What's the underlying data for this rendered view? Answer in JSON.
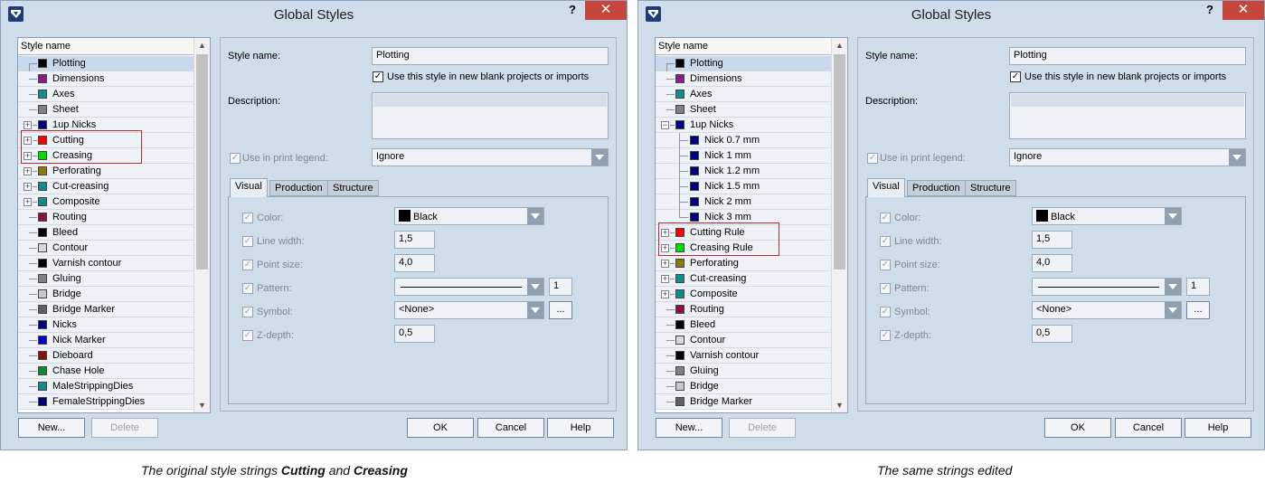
{
  "dialogs": [
    {
      "title": "Global Styles",
      "help_glyph": "?",
      "close_glyph": "✕",
      "list_header": "Style name",
      "rows": [
        {
          "label": "Plotting",
          "color": "#000000",
          "expander": "none",
          "selected": true
        },
        {
          "label": "Dimensions",
          "color": "#8b1a8b",
          "expander": "none"
        },
        {
          "label": "Axes",
          "color": "#1a8a8a",
          "expander": "none"
        },
        {
          "label": "Sheet",
          "color": "#808080",
          "expander": "none"
        },
        {
          "label": "1up Nicks",
          "color": "#00007f",
          "expander": "plus"
        },
        {
          "label": "Cutting",
          "color": "#ff0000",
          "expander": "plus"
        },
        {
          "label": "Creasing",
          "color": "#00dd00",
          "expander": "plus"
        },
        {
          "label": "Perforating",
          "color": "#8a7a10",
          "expander": "plus"
        },
        {
          "label": "Cut-creasing",
          "color": "#108a8a",
          "expander": "plus"
        },
        {
          "label": "Composite",
          "color": "#108a8a",
          "expander": "plus"
        },
        {
          "label": "Routing",
          "color": "#8a1040",
          "expander": "none"
        },
        {
          "label": "Bleed",
          "color": "#000000",
          "expander": "none"
        },
        {
          "label": "Contour",
          "color": "#d8d8d8",
          "expander": "none"
        },
        {
          "label": "Varnish contour",
          "color": "#000000",
          "expander": "none"
        },
        {
          "label": "Gluing",
          "color": "#808080",
          "expander": "none"
        },
        {
          "label": "Bridge",
          "color": "#c8c8c8",
          "expander": "none"
        },
        {
          "label": "Bridge Marker",
          "color": "#606060",
          "expander": "none"
        },
        {
          "label": "Nicks",
          "color": "#00007f",
          "expander": "none"
        },
        {
          "label": "Nick Marker",
          "color": "#0000cc",
          "expander": "none"
        },
        {
          "label": "Dieboard",
          "color": "#8a1010",
          "expander": "none"
        },
        {
          "label": "Chase Hole",
          "color": "#108a30",
          "expander": "none"
        },
        {
          "label": "MaleStrippingDies",
          "color": "#108a8a",
          "expander": "none"
        },
        {
          "label": "FemaleStrippingDies",
          "color": "#00007f",
          "expander": "none"
        }
      ],
      "caption_parts": [
        "The original style strings ",
        "Cutting",
        " and ",
        "Creasing"
      ]
    },
    {
      "title": "Global Styles",
      "help_glyph": "?",
      "close_glyph": "✕",
      "list_header": "Style name",
      "rows": [
        {
          "label": "Plotting",
          "color": "#000000",
          "expander": "none",
          "selected": true
        },
        {
          "label": "Dimensions",
          "color": "#8b1a8b",
          "expander": "none"
        },
        {
          "label": "Axes",
          "color": "#1a8a8a",
          "expander": "none"
        },
        {
          "label": "Sheet",
          "color": "#808080",
          "expander": "none"
        },
        {
          "label": "1up Nicks",
          "color": "#00007f",
          "expander": "minus"
        },
        {
          "label": "Nick 0.7 mm",
          "color": "#00007f",
          "expander": "child"
        },
        {
          "label": "Nick 1 mm",
          "color": "#00007f",
          "expander": "child"
        },
        {
          "label": "Nick 1.2 mm",
          "color": "#00007f",
          "expander": "child"
        },
        {
          "label": "Nick 1.5 mm",
          "color": "#00007f",
          "expander": "child"
        },
        {
          "label": "Nick 2 mm",
          "color": "#00007f",
          "expander": "child"
        },
        {
          "label": "Nick 3 mm",
          "color": "#00007f",
          "expander": "childlast"
        },
        {
          "label": "Cutting Rule",
          "color": "#ff0000",
          "expander": "plus"
        },
        {
          "label": "Creasing Rule",
          "color": "#00dd00",
          "expander": "plus"
        },
        {
          "label": "Perforating",
          "color": "#8a7a10",
          "expander": "plus"
        },
        {
          "label": "Cut-creasing",
          "color": "#108a8a",
          "expander": "plus"
        },
        {
          "label": "Composite",
          "color": "#108a8a",
          "expander": "plus"
        },
        {
          "label": "Routing",
          "color": "#8a1040",
          "expander": "none"
        },
        {
          "label": "Bleed",
          "color": "#000000",
          "expander": "none"
        },
        {
          "label": "Contour",
          "color": "#d8d8d8",
          "expander": "none"
        },
        {
          "label": "Varnish contour",
          "color": "#000000",
          "expander": "none"
        },
        {
          "label": "Gluing",
          "color": "#808080",
          "expander": "none"
        },
        {
          "label": "Bridge",
          "color": "#c8c8c8",
          "expander": "none"
        },
        {
          "label": "Bridge Marker",
          "color": "#606060",
          "expander": "none"
        }
      ],
      "caption_parts": [
        "The same strings edited"
      ]
    }
  ],
  "form": {
    "style_name_label": "Style name:",
    "style_name_value": "Plotting",
    "use_style_label": "Use this style in new blank projects or imports",
    "description_label": "Description:",
    "print_legend_label": "Use in print legend:",
    "print_legend_value": "Ignore",
    "tabs": [
      "Visual",
      "Production",
      "Structure"
    ],
    "color_label": "Color:",
    "color_value": "Black",
    "line_width_label": "Line width:",
    "line_width_value": "1,5",
    "point_size_label": "Point size:",
    "point_size_value": "4,0",
    "pattern_label": "Pattern:",
    "pattern_value": "1",
    "symbol_label": "Symbol:",
    "symbol_value": "<None>",
    "symbol_browse": "...",
    "zdepth_label": "Z-depth:",
    "zdepth_value": "0,5",
    "check_glyph": "✓"
  },
  "buttons": {
    "new": "New...",
    "delete": "Delete",
    "ok": "OK",
    "cancel": "Cancel",
    "help": "Help"
  },
  "colors": {
    "highlight": "#c0262d",
    "close": "#c7463c",
    "selection": "#c7d9ec"
  }
}
